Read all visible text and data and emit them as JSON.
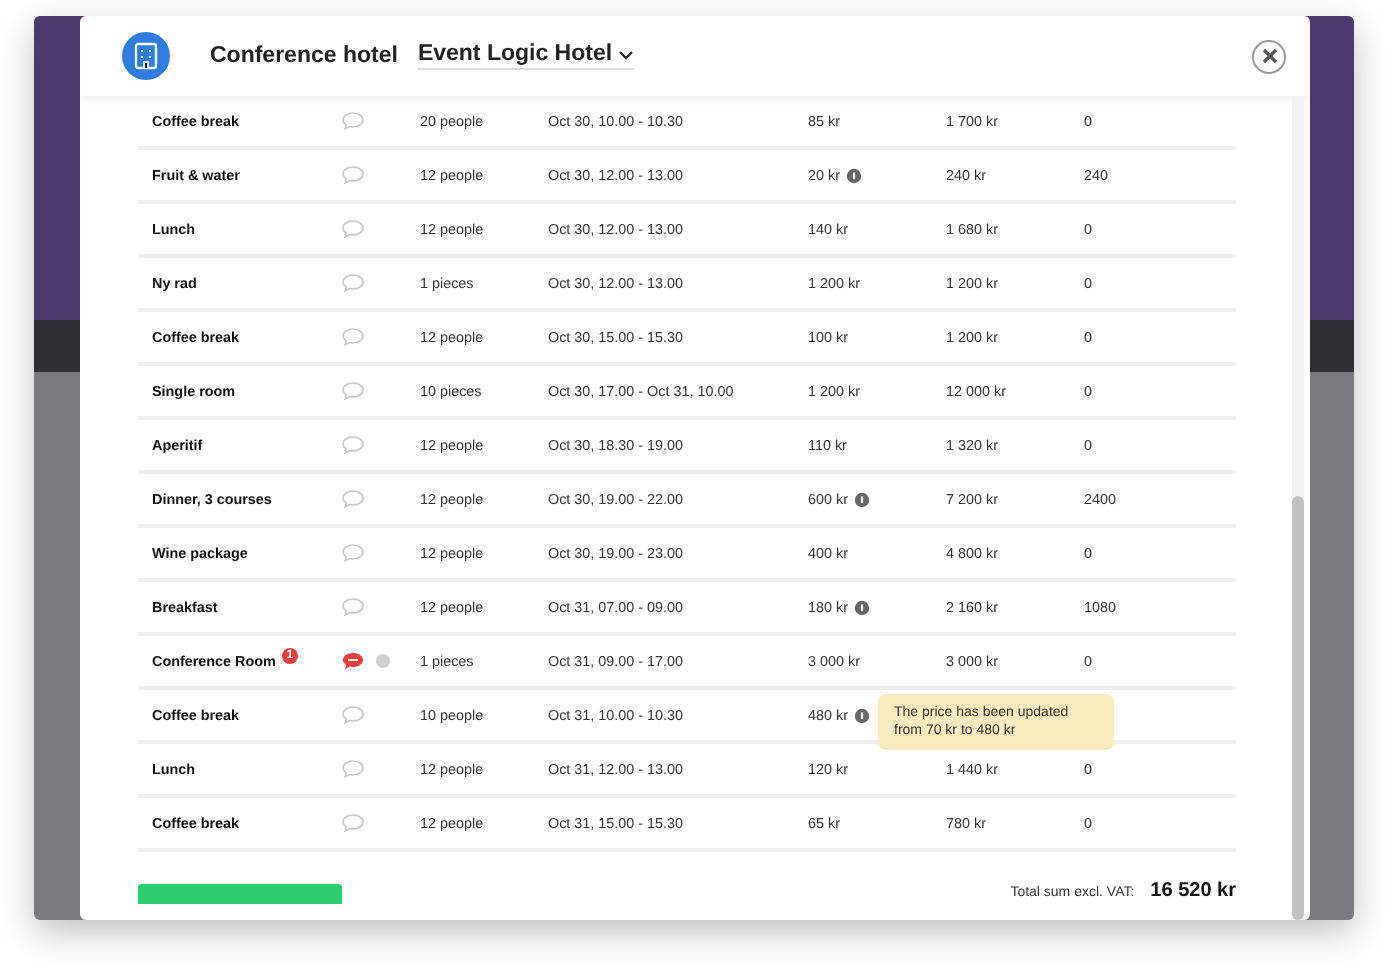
{
  "header": {
    "title": "Conference hotel",
    "hotel_select": "Event Logic Hotel"
  },
  "rows": [
    {
      "name": "Coffee break",
      "comment": false,
      "quantity": "20 people",
      "time": "Oct 30, 10.00 - 10.30",
      "price": "85 kr",
      "price_info": false,
      "total": "1 700 kr",
      "column_7": "0"
    },
    {
      "name": "Fruit & water",
      "comment": false,
      "quantity": "12 people",
      "time": "Oct 30, 12.00 - 13.00",
      "price": "20 kr",
      "price_info": true,
      "total": "240 kr",
      "column_7": "240"
    },
    {
      "name": "Lunch",
      "comment": false,
      "quantity": "12 people",
      "time": "Oct 30, 12.00 - 13.00",
      "price": "140 kr",
      "price_info": false,
      "total": "1 680 kr",
      "column_7": "0"
    },
    {
      "name": "Ny rad",
      "comment": false,
      "quantity": "1 pieces",
      "time": "Oct 30, 12.00 - 13.00",
      "price": "1 200 kr",
      "price_info": false,
      "total": "1 200 kr",
      "column_7": "0"
    },
    {
      "name": "Coffee break",
      "comment": false,
      "quantity": "12 people",
      "time": "Oct 30, 15.00 - 15.30",
      "price": "100 kr",
      "price_info": false,
      "total": "1 200 kr",
      "column_7": "0"
    },
    {
      "name": "Single room",
      "comment": false,
      "quantity": "10 pieces",
      "time": "Oct 30, 17.00 - Oct 31, 10.00",
      "price": "1 200 kr",
      "price_info": false,
      "total": "12 000 kr",
      "column_7": "0"
    },
    {
      "name": "Aperitif",
      "comment": false,
      "quantity": "12 people",
      "time": "Oct 30, 18.30 - 19.00",
      "price": "110 kr",
      "price_info": false,
      "total": "1 320 kr",
      "column_7": "0"
    },
    {
      "name": "Dinner, 3 courses",
      "comment": false,
      "quantity": "12 people",
      "time": "Oct 30, 19.00 - 22.00",
      "price": "600 kr",
      "price_info": true,
      "total": "7 200 kr",
      "column_7": "2400"
    },
    {
      "name": "Wine package",
      "comment": false,
      "quantity": "12 people",
      "time": "Oct 30, 19.00 - 23.00",
      "price": "400 kr",
      "price_info": false,
      "total": "4 800 kr",
      "column_7": "0"
    },
    {
      "name": "Breakfast",
      "comment": false,
      "quantity": "12 people",
      "time": "Oct 31, 07.00 - 09.00",
      "price": "180 kr",
      "price_info": true,
      "total": "2 160 kr",
      "column_7": "1080"
    },
    {
      "name": "Conference Room",
      "badge": "1",
      "comment": true,
      "quantity": "1 pieces",
      "time": "Oct 31, 09.00 - 17.00",
      "price": "3 000 kr",
      "price_info": false,
      "total": "3 000 kr",
      "column_7": "0"
    },
    {
      "name": "Coffee break",
      "comment": false,
      "quantity": "10 people",
      "time": "Oct 31, 10.00 - 10.30",
      "price": "480 kr",
      "price_info": true,
      "tooltip": "The price has been updated from 70 kr to 480 kr"
    },
    {
      "name": "Lunch",
      "comment": false,
      "quantity": "12 people",
      "time": "Oct 31, 12.00 - 13.00",
      "price": "120 kr",
      "price_info": false,
      "total": "1 440 kr",
      "column_7": "0"
    },
    {
      "name": "Coffee break",
      "comment": false,
      "quantity": "12 people",
      "time": "Oct 31, 15.00 - 15.30",
      "price": "65 kr",
      "price_info": false,
      "total": "780 kr",
      "column_7": "0"
    }
  ],
  "footer": {
    "total_label": "Total sum excl. VAT:",
    "total_value": "16 520 kr"
  }
}
